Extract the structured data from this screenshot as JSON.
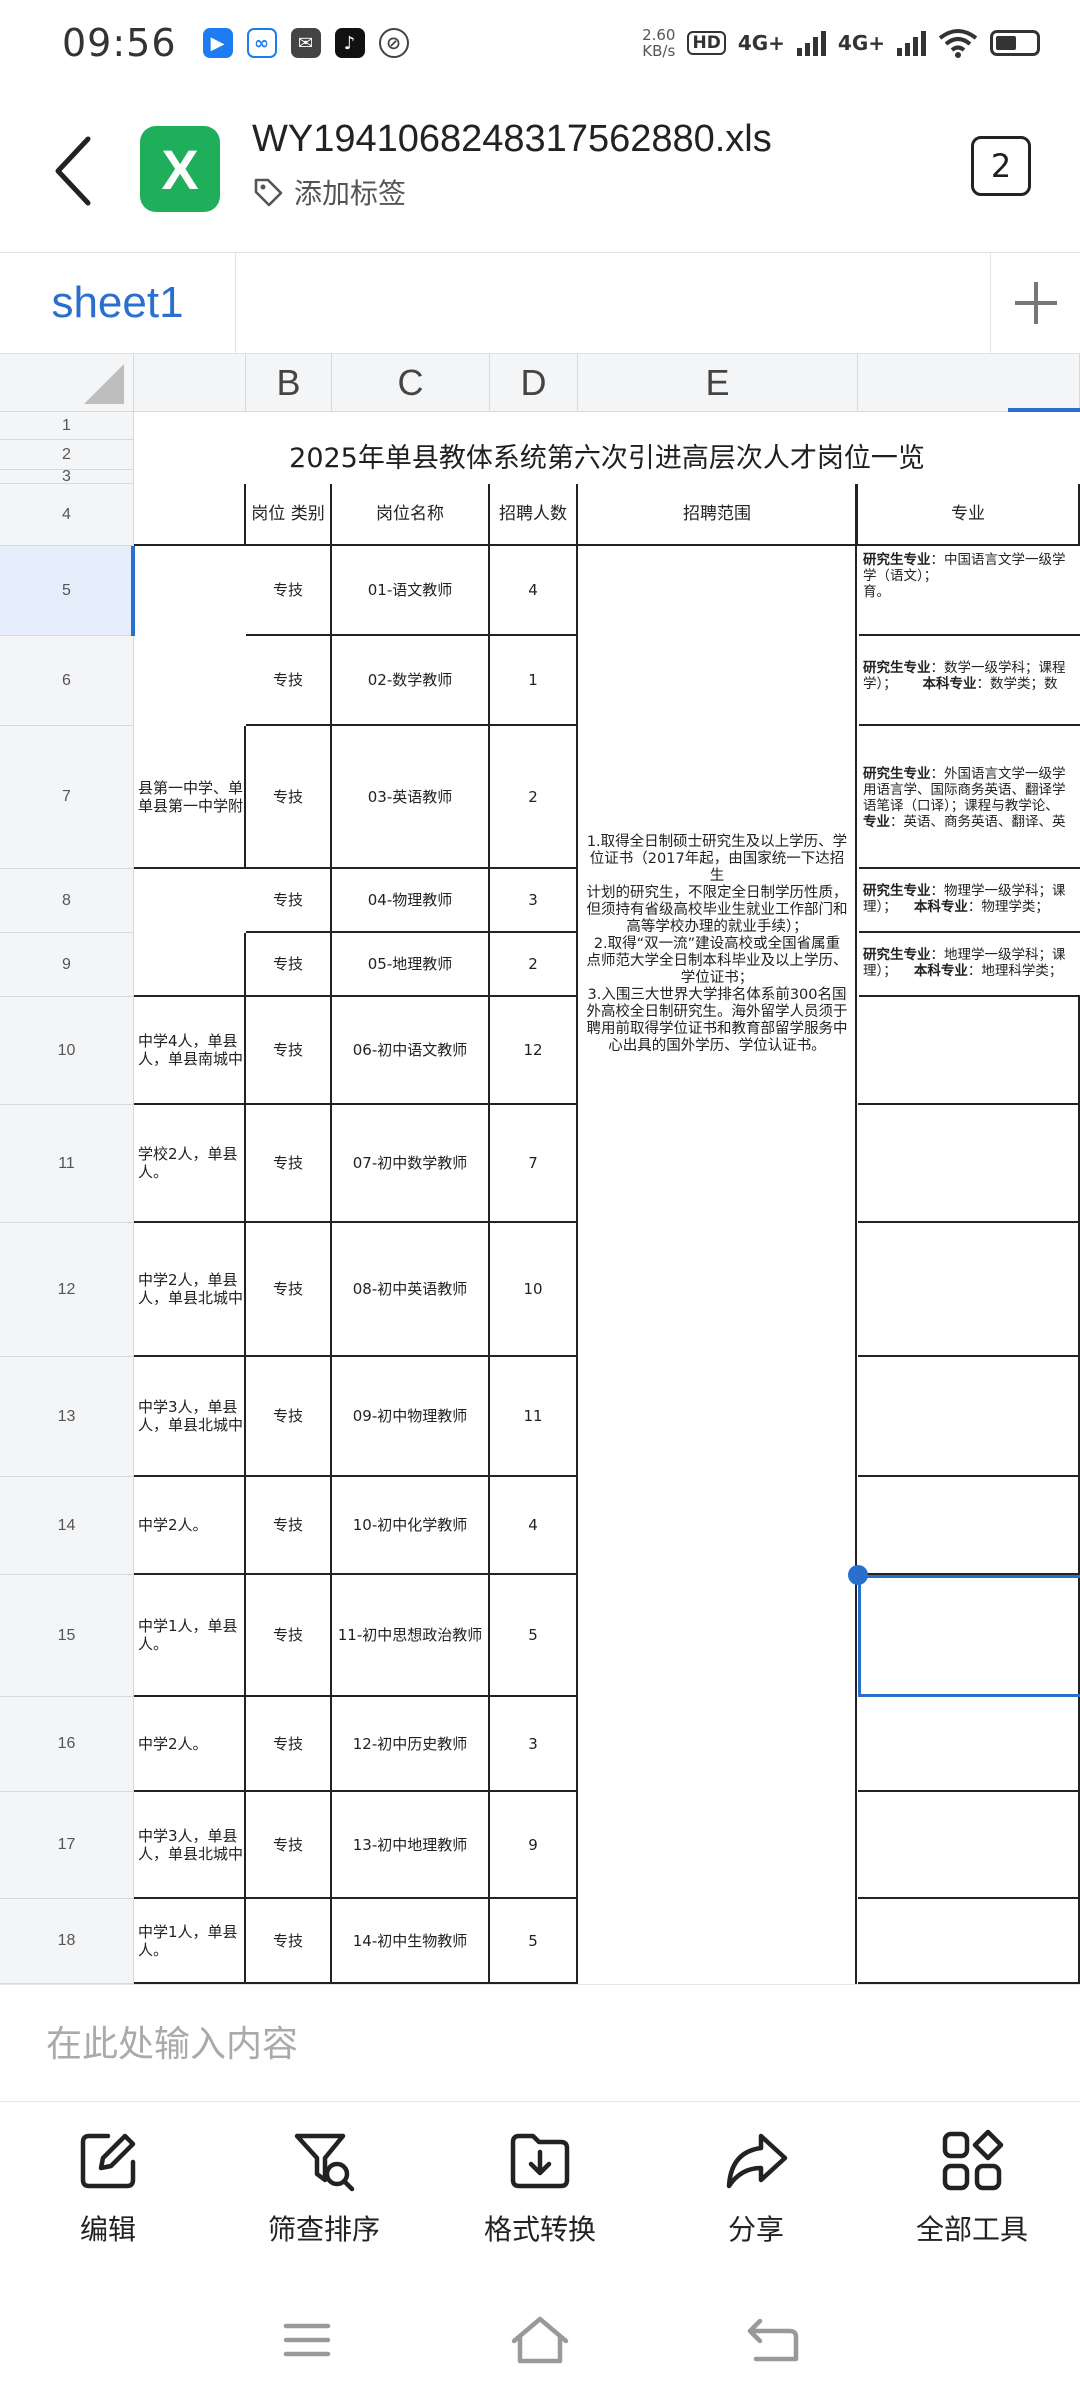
{
  "status_bar": {
    "time": "09:56",
    "speed_value": "2.60",
    "speed_unit": "KB/s",
    "hd_label": "HD",
    "net1": "4G+",
    "net2": "4G+"
  },
  "header": {
    "file_icon_letter": "X",
    "file_name": "WY1941068248317562880.xls",
    "add_tag_label": "添加标签",
    "page_count": "2"
  },
  "sheet_tabs": {
    "active": "sheet1"
  },
  "grid": {
    "columns": [
      "B",
      "C",
      "D",
      "E"
    ],
    "row_numbers": [
      "1",
      "2",
      "3",
      "4",
      "5",
      "6",
      "7",
      "8",
      "9",
      "10",
      "11",
      "12",
      "13",
      "14",
      "15",
      "16",
      "17",
      "18"
    ],
    "title": "2025年单县教体系统第六次引进高层次人才岗位一览",
    "headers": {
      "category": "岗位 类别",
      "position": "岗位名称",
      "count": "招聘人数",
      "range": "招聘范围",
      "major": "专业"
    },
    "rows": [
      {
        "unit": "",
        "category": "专技",
        "position": "01-语文教师",
        "count": "4"
      },
      {
        "unit": "",
        "category": "专技",
        "position": "02-数学教师",
        "count": "1"
      },
      {
        "unit": "县第一中学、单 单县第一中学附",
        "category": "专技",
        "position": "03-英语教师",
        "count": "2"
      },
      {
        "unit": "",
        "category": "专技",
        "position": "04-物理教师",
        "count": "3"
      },
      {
        "unit": "",
        "category": "专技",
        "position": "05-地理教师",
        "count": "2"
      },
      {
        "unit": "中学4人，单县 人，单县南城中",
        "category": "专技",
        "position": "06-初中语文教师",
        "count": "12"
      },
      {
        "unit": "学校2人，单县 人。",
        "category": "专技",
        "position": "07-初中数学教师",
        "count": "7"
      },
      {
        "unit": "中学2人，单县 人，单县北城中",
        "category": "专技",
        "position": "08-初中英语教师",
        "count": "10"
      },
      {
        "unit": "中学3人，单县 人，单县北城中",
        "category": "专技",
        "position": "09-初中物理教师",
        "count": "11"
      },
      {
        "unit": "中学2人。",
        "category": "专技",
        "position": "10-初中化学教师",
        "count": "4"
      },
      {
        "unit": "中学1人，单县 人。",
        "category": "专技",
        "position": "11-初中思想政治教师",
        "count": "5"
      },
      {
        "unit": "中学2人。",
        "category": "专技",
        "position": "12-初中历史教师",
        "count": "3"
      },
      {
        "unit": "中学3人，单县 人，单县北城中",
        "category": "专技",
        "position": "13-初中地理教师",
        "count": "9"
      },
      {
        "unit": "中学1人，单县 人。",
        "category": "专技",
        "position": "14-初中生物教师",
        "count": "5"
      }
    ],
    "range_text": [
      "1.取得全日制硕士研究生及以上学历、学",
      "位证书（2017年起，由国家统一下达招生",
      "计划的研究生，不限定全日制学历性质，",
      "但须持有省级高校毕业生就业工作部门和",
      "高等学校办理的就业手续）；",
      "2.取得“双一流”建设高校或全国省属重",
      "点师范大学全日制本科毕业及以上学历、",
      "学位证书；",
      "3.入围三大世界大学排名体系前300名国",
      "外高校全日制研究生。海外留学人员须于",
      "聘用前取得学位证书和教育部留学服务中",
      "心出具的国外学历、学位认证书。"
    ],
    "majors": [
      {
        "a_label": "研究生专业",
        "a_text": "：中国语言文学一级学",
        "b_text": "学（语文）；",
        "c_text": "育。"
      },
      {
        "a_label": "研究生专业",
        "a_text": "：数学一级学科；课程",
        "b_text": "学）；",
        "b_label": "本科专业",
        "b_after": "：数学类；数"
      },
      {
        "a_label": "研究生专业",
        "a_text": "：外国语言文学一级学",
        "b_text": "用语言学、国际商务英语、翻译学",
        "c_text": "语笔译（口译）；课程与教学论、",
        "d_label": "专业",
        "d_text": "：英语、商务英语、翻译、英"
      },
      {
        "a_label": "研究生专业",
        "a_text": "：物理学一级学科；课",
        "b_text": "理）；",
        "b_label": "本科专业",
        "b_after": "：物理学类；"
      },
      {
        "a_label": "研究生专业",
        "a_text": "：地理学一级学科；课",
        "b_text": "理）；",
        "b_label": "本科专业",
        "b_after": "：地理科学类；"
      }
    ]
  },
  "input": {
    "placeholder": "在此处输入内容"
  },
  "toolbar": [
    {
      "label": "编辑",
      "icon": "edit-icon"
    },
    {
      "label": "筛查排序",
      "icon": "filter-search-icon"
    },
    {
      "label": "格式转换",
      "icon": "folder-convert-icon"
    },
    {
      "label": "分享",
      "icon": "share-icon"
    },
    {
      "label": "全部工具",
      "icon": "all-tools-icon"
    }
  ],
  "colors": {
    "accent": "#2a6fce",
    "excel_green": "#1faf5a"
  }
}
